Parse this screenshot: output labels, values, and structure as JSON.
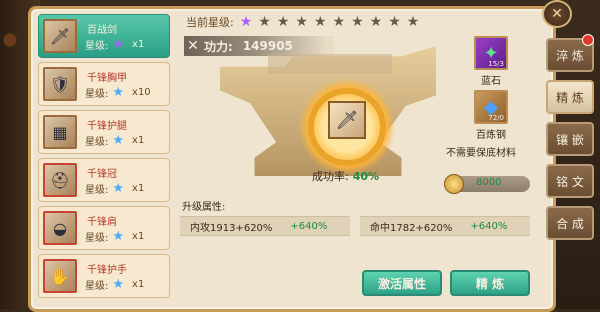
{
  "equip_list": [
    {
      "name": "百战剑",
      "star_label": "星级:",
      "star_color": "purple",
      "count": "x1",
      "thumb_icon": "sword-icon",
      "active": true
    },
    {
      "name": "千锋胸甲",
      "star_label": "星级:",
      "star_color": "blue",
      "count": "x10",
      "thumb_icon": "armor-icon",
      "active": false
    },
    {
      "name": "千锋护腿",
      "star_label": "星级:",
      "star_color": "blue",
      "count": "x1",
      "thumb_icon": "leg-armor-icon",
      "active": false
    },
    {
      "name": "千锋冠",
      "star_label": "星级:",
      "star_color": "blue",
      "count": "x1",
      "thumb_icon": "helmet-icon",
      "active": false
    },
    {
      "name": "千锋肩",
      "star_label": "星级:",
      "star_color": "blue",
      "count": "x1",
      "thumb_icon": "shoulder-icon",
      "active": false
    },
    {
      "name": "千锋护手",
      "star_label": "星级:",
      "star_color": "blue",
      "count": "x1",
      "thumb_icon": "gauntlet-icon",
      "active": false
    }
  ],
  "current_star": {
    "label": "当前星级:",
    "total": 10,
    "lit": 1
  },
  "power": {
    "label": "功力:",
    "value": "149905"
  },
  "success": {
    "label": "成功率:",
    "value": "40%"
  },
  "materials": [
    {
      "name": "蓝石",
      "count": "15/3",
      "icon": "gem-icon",
      "color": "#3fbf6a"
    },
    {
      "name": "百炼钢",
      "count": "72/0",
      "icon": "crystal-icon",
      "color": "#4aa0ff"
    }
  ],
  "no_protect_note": "不需要保底材料",
  "coin": {
    "value": "8000"
  },
  "upgrade": {
    "label": "升级属性:",
    "stats": [
      {
        "name": "内攻",
        "value": "1913+620%",
        "add": "+640%"
      },
      {
        "name": "命中",
        "value": "1782+620%",
        "add": "+640%"
      }
    ]
  },
  "buttons": {
    "activate": "激活属性",
    "refine": "精 炼"
  },
  "tabs": [
    {
      "label": "淬 炼",
      "active": false,
      "badge": true
    },
    {
      "label": "精 炼",
      "active": true,
      "badge": false
    },
    {
      "label": "镶 嵌",
      "active": false,
      "badge": false
    },
    {
      "label": "铭 文",
      "active": false,
      "badge": false
    },
    {
      "label": "合 成",
      "active": false,
      "badge": false
    }
  ],
  "colors": {
    "accent_green": "#2ea286",
    "star_purple": "#a860ff",
    "star_blue": "#48a9ff"
  }
}
